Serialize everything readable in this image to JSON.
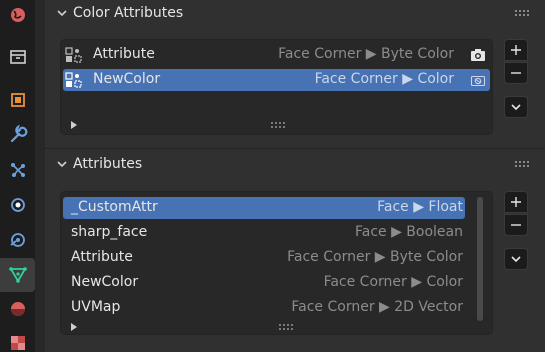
{
  "tabs": [
    {
      "icon": "world-icon"
    },
    {
      "icon": "collection-icon"
    },
    {
      "icon": "object-icon"
    },
    {
      "icon": "modifier-wrench-icon"
    },
    {
      "icon": "particles-icon"
    },
    {
      "icon": "physics-icon"
    },
    {
      "icon": "constraints-icon"
    },
    {
      "icon": "mesh-data-icon",
      "active": true
    },
    {
      "icon": "material-icon"
    },
    {
      "icon": "texture-icon"
    }
  ],
  "color_attributes": {
    "title": "Color Attributes",
    "items": [
      {
        "name": "Attribute",
        "domain": "Face Corner ▶ Byte Color",
        "icon": "color-attribute-icon",
        "render_icon": "camera-icon",
        "selected": false
      },
      {
        "name": "NewColor",
        "domain": "Face Corner ▶ Color",
        "icon": "color-attribute-icon",
        "render_icon": "camera-outline-icon",
        "selected": true
      }
    ]
  },
  "attributes": {
    "title": "Attributes",
    "items": [
      {
        "name": "_CustomAttr",
        "domain": "Face ▶ Float",
        "selected": true
      },
      {
        "name": "sharp_face",
        "domain": "Face ▶ Boolean",
        "selected": false
      },
      {
        "name": "Attribute",
        "domain": "Face Corner ▶ Byte Color",
        "selected": false
      },
      {
        "name": "NewColor",
        "domain": "Face Corner ▶ Color",
        "selected": false
      },
      {
        "name": "UVMap",
        "domain": "Face Corner ▶ 2D Vector",
        "selected": false
      }
    ]
  },
  "buttons": {
    "add": "+",
    "remove": "−"
  }
}
